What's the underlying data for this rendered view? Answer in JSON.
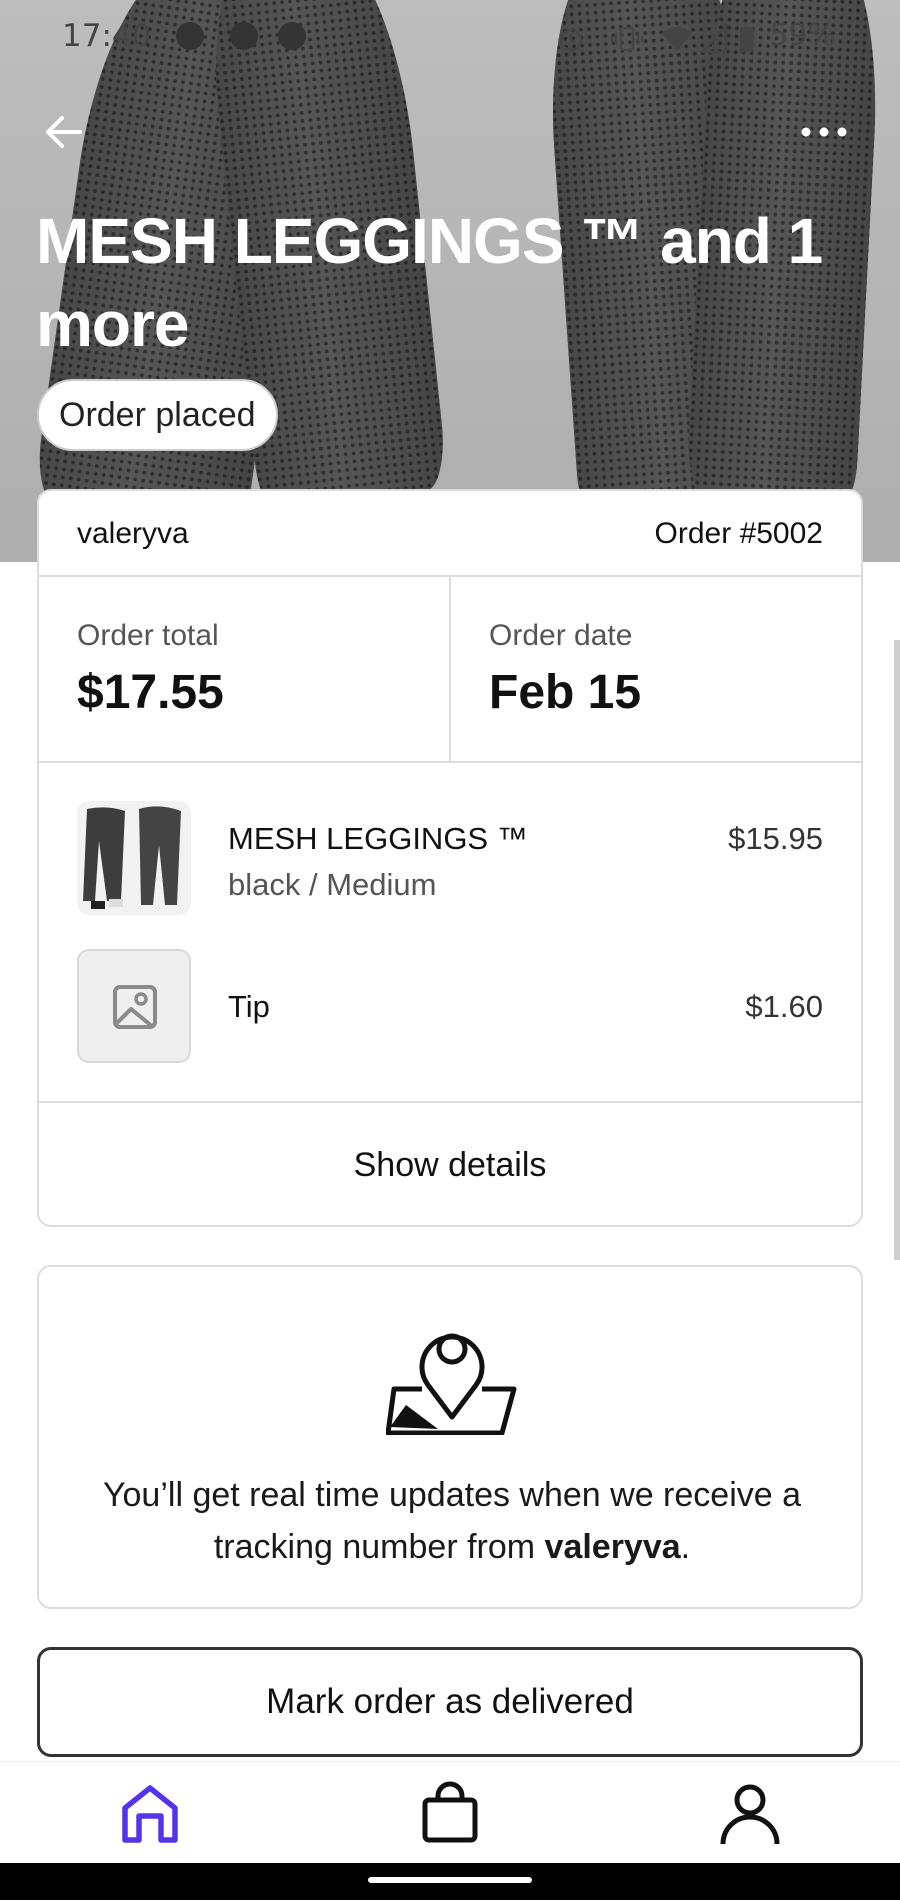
{
  "status_bar": {
    "time": "17:40",
    "battery": "59%"
  },
  "header": {
    "title": "MESH LEGGINGS ™ and 1 more",
    "status_pill": "Order placed"
  },
  "order": {
    "shop": "valeryva",
    "order_number": "Order #5002",
    "total_label": "Order total",
    "total_value": "$17.55",
    "date_label": "Order date",
    "date_value": "Feb 15",
    "items": [
      {
        "name": "MESH LEGGINGS ™",
        "variant": "black / Medium",
        "price": "$15.95"
      },
      {
        "name": "Tip",
        "variant": "",
        "price": "$1.60"
      }
    ],
    "show_details": "Show details"
  },
  "tracking": {
    "text_prefix": "You’ll get real time updates when we receive a tracking number from ",
    "shop": "valeryva",
    "text_suffix": "."
  },
  "actions": {
    "mark_delivered": "Mark order as delivered"
  },
  "nav": {
    "active": "home",
    "accent": "#5433EB"
  }
}
